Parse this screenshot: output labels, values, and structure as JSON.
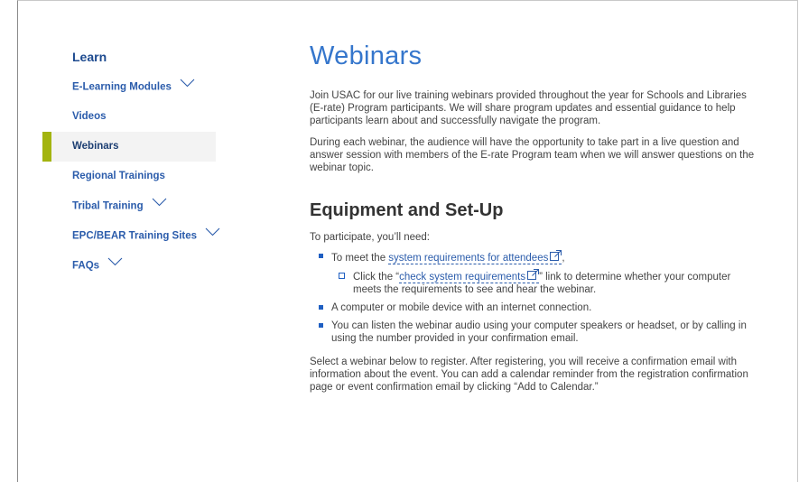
{
  "sidebar": {
    "heading": "Learn",
    "items": [
      {
        "label": "E-Learning Modules",
        "has_chevron": true
      },
      {
        "label": "Videos",
        "has_chevron": false
      },
      {
        "label": "Webinars",
        "has_chevron": false,
        "active": true
      },
      {
        "label": "Regional Trainings",
        "has_chevron": false
      },
      {
        "label": "Tribal Training",
        "has_chevron": true
      },
      {
        "label": "EPC/BEAR Training Sites",
        "has_chevron": true
      },
      {
        "label": "FAQs",
        "has_chevron": true
      }
    ]
  },
  "main": {
    "title": "Webinars",
    "intro": "Join USAC for our live training webinars provided throughout the year for Schools and Libraries (E-rate) Program participants. We will share program updates and essential guidance to help participants learn about and successfully navigate the program.",
    "intro2": "During each webinar, the audience will have the opportunity to take part in a live question and answer session with members of the E-rate Program team when we will answer questions on the webinar topic.",
    "section_title": "Equipment and Set-Up",
    "lead": "To participate, you’ll need:",
    "bullet1_prefix": "To meet the ",
    "bullet1_link": "system requirements for attendees",
    "bullet1_suffix": ",",
    "sub1_prefix": "Click the “",
    "sub1_link": "check system requirements",
    "sub1_suffix": "” link to determine whether your computer meets the requirements to see and hear the webinar.",
    "bullet2": "A computer or mobile device with an internet connection.",
    "bullet3": "You can listen the webinar audio using your computer speakers or headset, or by calling in using the number provided in your confirmation email.",
    "closing": "Select a webinar below to register. After registering, you will receive a confirmation email with information about the event. You can add a calendar reminder from the registration confirmation page or event confirmation email by clicking “Add to Calendar.”"
  },
  "colors": {
    "title_blue": "#3576cc",
    "link_blue": "#2b5cab",
    "active_marker": "#a3b40f",
    "bullet_blue": "#1f5fc2"
  }
}
